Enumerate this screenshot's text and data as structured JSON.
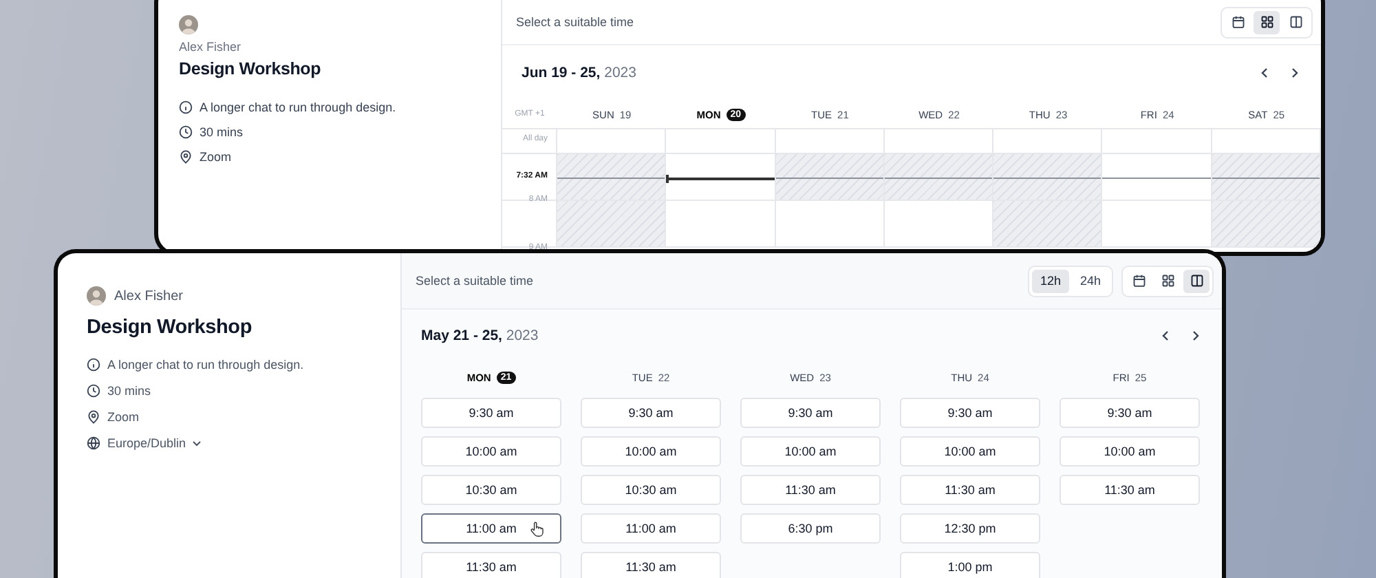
{
  "back_window": {
    "host": {
      "name": "Alex Fisher"
    },
    "event": {
      "title": "Design Workshop",
      "details": [
        {
          "kind": "info",
          "text": "A longer chat to run through design."
        },
        {
          "kind": "duration",
          "text": "30 mins"
        },
        {
          "kind": "location",
          "text": "Zoom"
        }
      ]
    },
    "header": {
      "prompt": "Select a suitable time",
      "views": [
        {
          "kind": "month",
          "selected": false
        },
        {
          "kind": "week",
          "selected": true
        },
        {
          "kind": "column",
          "selected": false
        }
      ]
    },
    "range": {
      "dates": "Jun 19 - 25,",
      "year": "2023"
    },
    "timezone": "GMT +1",
    "all_day_label": "All day",
    "now_label": "7:32 AM",
    "hour_labels": [
      "8 AM",
      "9 AM"
    ],
    "days": [
      {
        "weekday": "SUN",
        "date": "19",
        "today": false,
        "unavailable": [
          true,
          true
        ]
      },
      {
        "weekday": "MON",
        "date": "20",
        "today": true,
        "unavailable": [
          false,
          false
        ]
      },
      {
        "weekday": "TUE",
        "date": "21",
        "today": false,
        "unavailable": [
          true,
          false
        ]
      },
      {
        "weekday": "WED",
        "date": "22",
        "today": false,
        "unavailable": [
          true,
          false
        ]
      },
      {
        "weekday": "THU",
        "date": "23",
        "today": false,
        "unavailable": [
          true,
          true
        ]
      },
      {
        "weekday": "FRI",
        "date": "24",
        "today": false,
        "unavailable": [
          false,
          false
        ]
      },
      {
        "weekday": "SAT",
        "date": "25",
        "today": false,
        "unavailable": [
          true,
          true
        ]
      }
    ]
  },
  "front_window": {
    "host": {
      "name": "Alex Fisher"
    },
    "event": {
      "title": "Design Workshop",
      "details": [
        {
          "kind": "info",
          "text": "A longer chat to run through design."
        },
        {
          "kind": "duration",
          "text": "30 mins"
        },
        {
          "kind": "location",
          "text": "Zoom"
        },
        {
          "kind": "timezone",
          "text": "Europe/Dublin"
        }
      ]
    },
    "header": {
      "prompt": "Select a suitable time",
      "formats": [
        {
          "label": "12h",
          "selected": true
        },
        {
          "label": "24h",
          "selected": false
        }
      ],
      "views": [
        {
          "kind": "month",
          "selected": false
        },
        {
          "kind": "week",
          "selected": false
        },
        {
          "kind": "column",
          "selected": true
        }
      ]
    },
    "range": {
      "dates": "May 21 - 25,",
      "year": "2023"
    },
    "days": [
      {
        "weekday": "MON",
        "date": "21",
        "today": true,
        "slots": [
          {
            "time": "9:30 am",
            "selected": false
          },
          {
            "time": "10:00 am",
            "selected": false
          },
          {
            "time": "10:30 am",
            "selected": false
          },
          {
            "time": "11:00 am",
            "selected": true
          },
          {
            "time": "11:30 am",
            "selected": false
          }
        ]
      },
      {
        "weekday": "TUE",
        "date": "22",
        "today": false,
        "slots": [
          {
            "time": "9:30 am",
            "selected": false
          },
          {
            "time": "10:00 am",
            "selected": false
          },
          {
            "time": "10:30 am",
            "selected": false
          },
          {
            "time": "11:00 am",
            "selected": false
          },
          {
            "time": "11:30 am",
            "selected": false
          }
        ]
      },
      {
        "weekday": "WED",
        "date": "23",
        "today": false,
        "slots": [
          {
            "time": "9:30 am",
            "selected": false
          },
          {
            "time": "10:00 am",
            "selected": false
          },
          {
            "time": "11:30 am",
            "selected": false
          },
          {
            "time": "6:30 pm",
            "selected": false
          }
        ]
      },
      {
        "weekday": "THU",
        "date": "24",
        "today": false,
        "slots": [
          {
            "time": "9:30 am",
            "selected": false
          },
          {
            "time": "10:00 am",
            "selected": false
          },
          {
            "time": "11:30 am",
            "selected": false
          },
          {
            "time": "12:30 pm",
            "selected": false
          },
          {
            "time": "1:00 pm",
            "selected": false
          }
        ]
      },
      {
        "weekday": "FRI",
        "date": "25",
        "today": false,
        "slots": [
          {
            "time": "9:30 am",
            "selected": false
          },
          {
            "time": "10:00 am",
            "selected": false
          },
          {
            "time": "11:30 am",
            "selected": false
          }
        ]
      }
    ]
  }
}
